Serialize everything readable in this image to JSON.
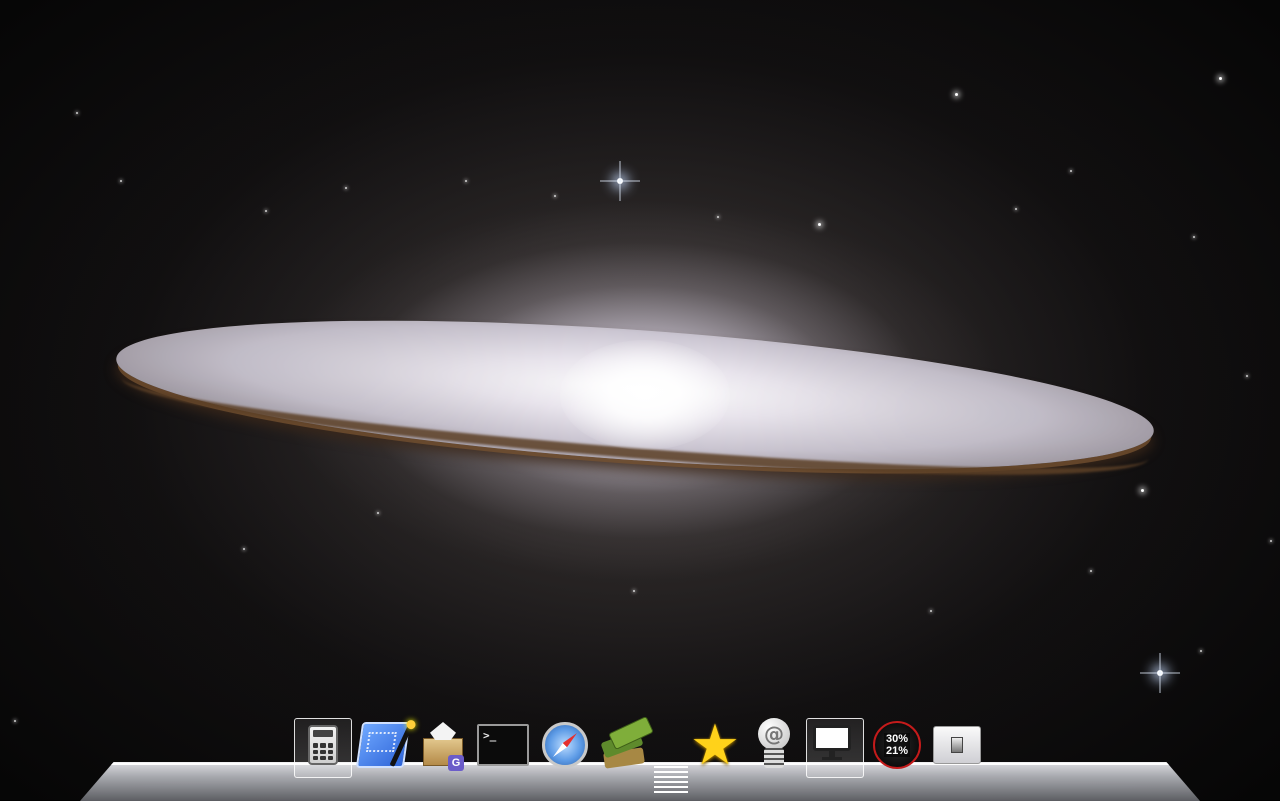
{
  "desktop": {
    "wallpaper": "sombrero-galaxy-wallpaper",
    "colors": {
      "space": "#050505",
      "disk": "#eeeaf2",
      "dust_lane": "#6b4a2c"
    }
  },
  "dock": {
    "items": [
      {
        "id": "calculator",
        "icon": "calculator-icon",
        "running": true
      },
      {
        "id": "interface-builder",
        "icon": "interface-builder-icon",
        "running": false
      },
      {
        "id": "package-installer",
        "icon": "package-icon",
        "badge": "G",
        "running": false
      },
      {
        "id": "terminal",
        "icon": "terminal-icon",
        "prompt": ">_",
        "running": false
      },
      {
        "id": "safari",
        "icon": "safari-compass-icon",
        "running": false
      },
      {
        "id": "dictionary",
        "icon": "books-icon",
        "running": false
      },
      {
        "id": "stack",
        "icon": "stack-icon",
        "running": false
      },
      {
        "id": "favorites",
        "icon": "star-icon",
        "running": false
      },
      {
        "id": "mail",
        "icon": "mail-at-icon",
        "running": false
      },
      {
        "id": "screen-sharing",
        "icon": "monitor-icon",
        "running": true
      },
      {
        "id": "system-monitor",
        "icon": "gauge-icon",
        "cpu": "30%",
        "mem": "21%",
        "running": false
      },
      {
        "id": "light-switch",
        "icon": "switch-icon",
        "running": false
      }
    ]
  }
}
